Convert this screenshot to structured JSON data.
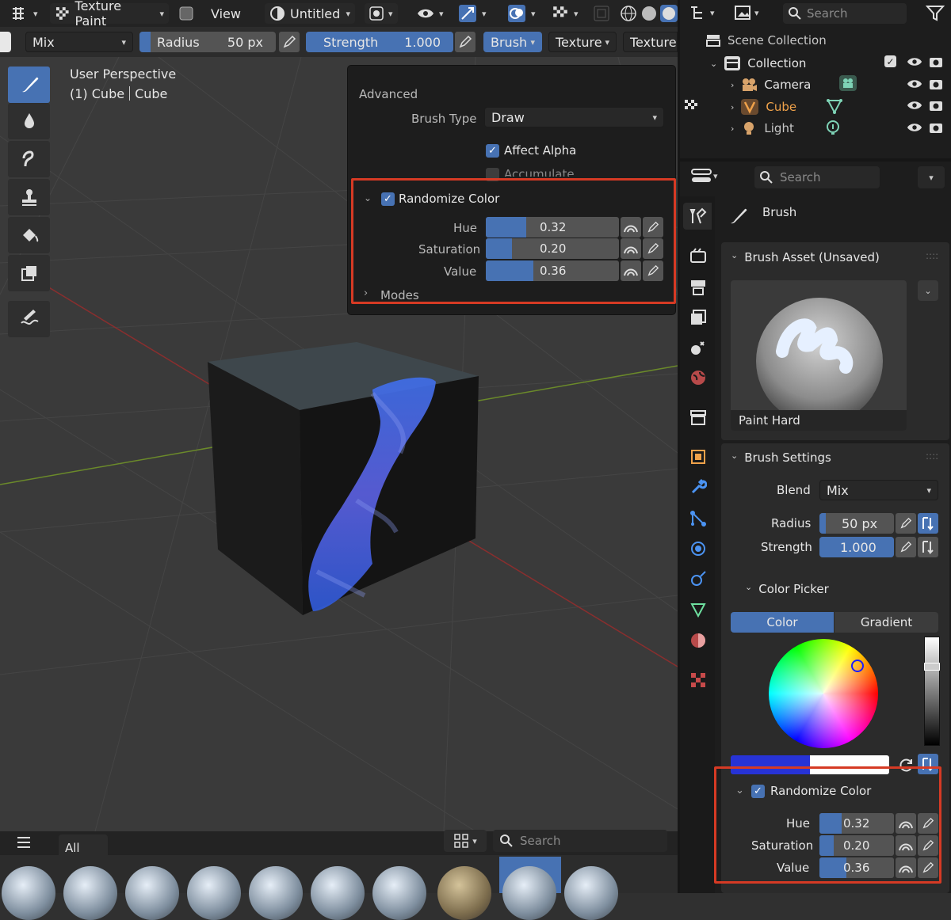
{
  "header": {
    "mode_label": "Texture Paint",
    "view_label": "View",
    "image_label": "Untitled"
  },
  "toolsettings": {
    "blend": "Mix",
    "radius_label": "Radius",
    "radius_value": "50 px",
    "strength_label": "Strength",
    "strength_value": "1.000",
    "brush_menu": "Brush",
    "texture_menu": "Texture",
    "texture_menu2": "Texture"
  },
  "viewport": {
    "perspective": "User Perspective",
    "object_info_left": "(1) Cube",
    "object_info_right": "Cube"
  },
  "popover": {
    "section": "Advanced",
    "brush_type_label": "Brush Type",
    "brush_type_value": "Draw",
    "affect_alpha": "Affect Alpha",
    "accumulate": "Accumulate",
    "randomize_color": "Randomize Color",
    "hue_label": "Hue",
    "hue_value": "0.32",
    "hue_fraction": 0.32,
    "saturation_label": "Saturation",
    "saturation_value": "0.20",
    "saturation_fraction": 0.2,
    "value_label": "Value",
    "value_value": "0.36",
    "value_fraction": 0.36,
    "modes": "Modes"
  },
  "outliner": {
    "search_placeholder": "Search",
    "scene_collection": "Scene Collection",
    "collection": "Collection",
    "items": [
      {
        "label": "Camera"
      },
      {
        "label": "Cube"
      },
      {
        "label": "Light"
      }
    ]
  },
  "properties": {
    "search_placeholder": "Search",
    "brush_title": "Brush",
    "brush_asset_panel": "Brush Asset (Unsaved)",
    "brush_name": "Paint Hard",
    "brush_settings_panel": "Brush Settings",
    "blend_label": "Blend",
    "blend_value": "Mix",
    "radius_label": "Radius",
    "radius_value": "50 px",
    "strength_label": "Strength",
    "strength_value": "1.000",
    "color_picker_panel": "Color Picker",
    "color_tab": "Color",
    "gradient_tab": "Gradient",
    "randomize_color": "Randomize Color",
    "hue_label": "Hue",
    "hue_value": "0.32",
    "saturation_label": "Saturation",
    "saturation_value": "0.20",
    "value_label": "Value",
    "value_value": "0.36"
  },
  "asset_shelf": {
    "filter_all": "All",
    "search_placeholder": "Search"
  },
  "colors": {
    "accent": "#4772b3",
    "highlight_box": "#d63a24",
    "primary_color": "#2733d6",
    "secondary_color": "#ffffff",
    "active_object": "#f0a24a"
  }
}
